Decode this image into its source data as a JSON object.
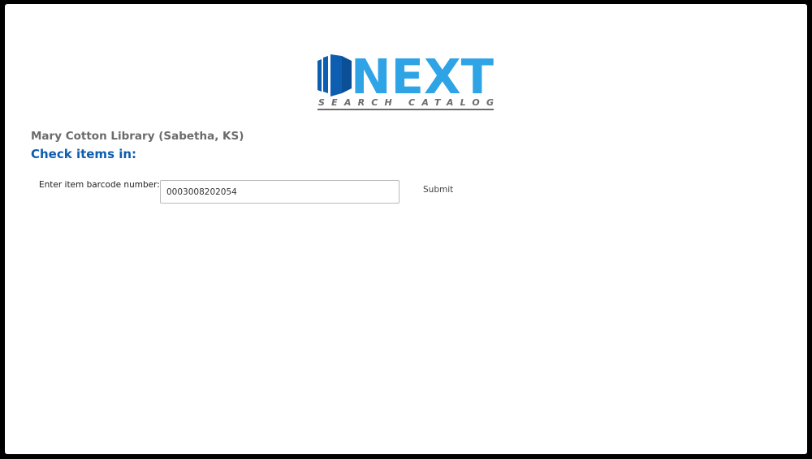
{
  "logo": {
    "wordmark": "NEXT",
    "tagline": "SEARCH CATALOG",
    "colors": {
      "dark_blue": "#0d5eb0",
      "light_blue": "#2ea3e6",
      "gray": "#6b6b6b"
    }
  },
  "library": {
    "name": "Mary Cotton Library (Sabetha, KS)"
  },
  "page": {
    "heading": "Check items in:"
  },
  "checkin_form": {
    "barcode_label": "Enter item barcode number:",
    "barcode_value": "0003008202054",
    "submit_label": "Submit"
  },
  "colors": {
    "heading_blue": "#0d5eb0",
    "library_gray": "#6b6b6b",
    "frame_background": "#ffffff",
    "outer_border": "#000000"
  }
}
